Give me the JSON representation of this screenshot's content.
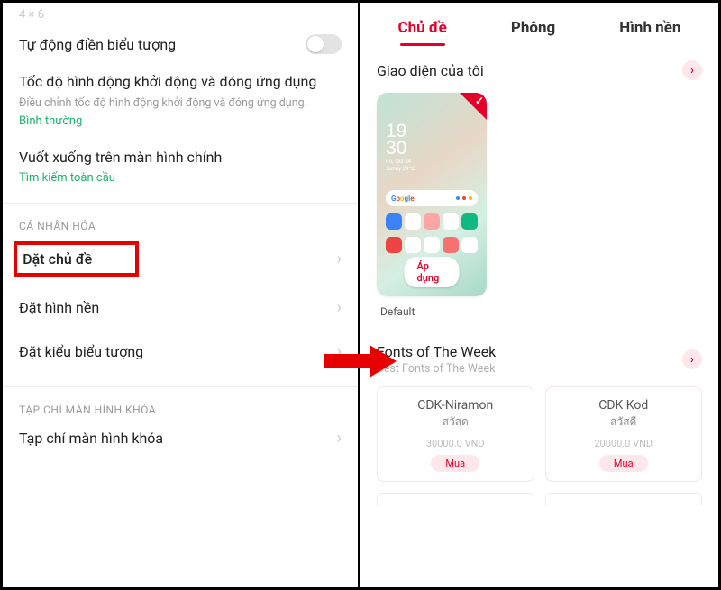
{
  "left": {
    "faded_layout": "4 × 6",
    "auto_fill": {
      "label": "Tự động điền biểu tượng"
    },
    "anim_speed": {
      "title": "Tốc độ hình động khởi động và đóng ứng dụng",
      "desc": "Điều chỉnh tốc độ hình động khởi động và đóng ứng dụng.",
      "value": "Bình thường"
    },
    "swipe_down": {
      "title": "Vuốt xuống trên màn hình chính",
      "value": "Tìm kiếm toàn cầu"
    },
    "personalize_header": "CÁ NHÂN HÓA",
    "set_theme": "Đặt chủ đề",
    "set_wallpaper": "Đặt hình nền",
    "set_icon_style": "Đặt kiểu biểu tượng",
    "lock_mag_header": "TẠP CHÍ MÀN HÌNH KHÓA",
    "lock_mag": "Tạp chí màn hình khóa"
  },
  "right": {
    "tabs": {
      "theme": "Chủ đề",
      "font": "Phông",
      "wallpaper": "Hình nền"
    },
    "my_ui": "Giao diện của tôi",
    "theme": {
      "clock_hh": "19",
      "clock_mm": "30",
      "clock_day1": "Fri, Oct 24",
      "clock_day2": "Sunny 24°C",
      "apply": "Áp dụng",
      "name": "Default",
      "search_brand": "Google"
    },
    "fonts_section": {
      "title": "Fonts of The Week",
      "sub": "Best Fonts of The Week"
    },
    "fonts": [
      {
        "name": "CDK-Niramon",
        "sample": "สวัสด",
        "price": "30000.0 VND",
        "buy": "Mua"
      },
      {
        "name": "CDK Kod",
        "sample": "สวัสดี",
        "price": "20000.0 VND",
        "buy": "Mua"
      }
    ]
  }
}
